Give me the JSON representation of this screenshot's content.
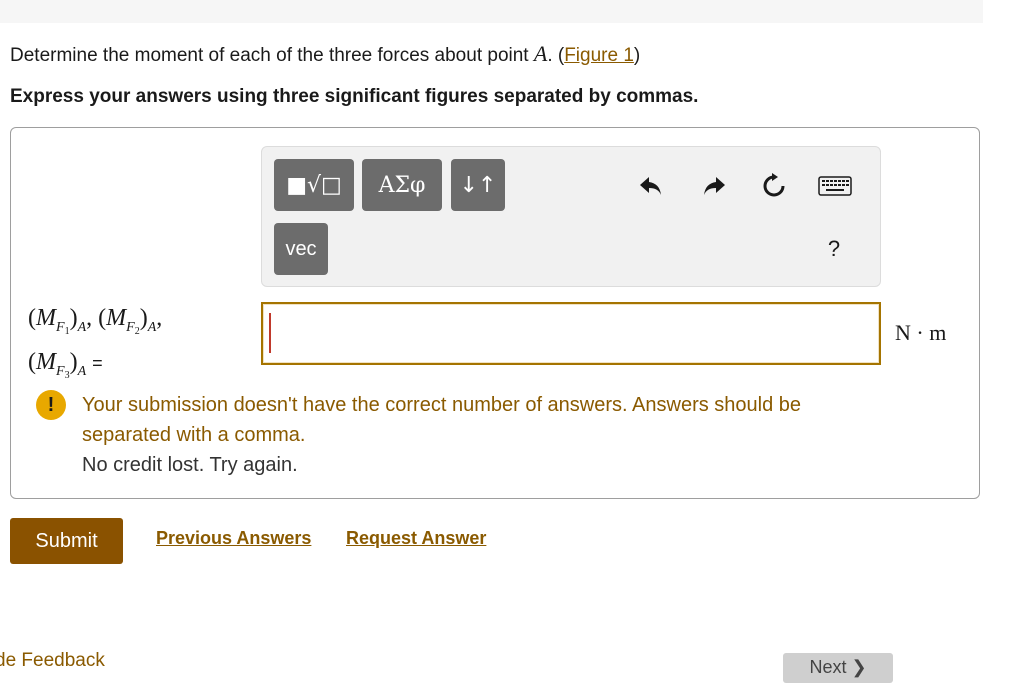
{
  "question": {
    "prefix": "Determine the moment of each of the three forces about point ",
    "point": "A",
    "middle": ". (",
    "figure_link": "Figure 1",
    "suffix": ")"
  },
  "instructions": "Express your answers using three significant figures separated by commas.",
  "toolbar": {
    "templates_glyph": "■√□",
    "greek_label": "ΑΣφ",
    "arrows_label": "↓↑",
    "vec_label": "vec",
    "help_label": "?",
    "undo_icon": "undo-icon",
    "redo_icon": "redo-icon",
    "reset_icon": "reset-icon",
    "keyboard_icon": "keyboard-icon"
  },
  "answer": {
    "value": "",
    "units": "N · m"
  },
  "feedback": {
    "message": "Your submission doesn't have the correct number of answers. Answers should be separated with a comma.",
    "sub": "No credit lost. Try again.",
    "icon_color": "#e8a800",
    "text_color": "#8a5a00"
  },
  "actions": {
    "submit_label": "Submit",
    "previous_answers_label": "Previous Answers",
    "request_answer_label": "Request Answer",
    "provide_feedback_label": "de Feedback",
    "next_label": "Next ❯"
  },
  "colors": {
    "accent": "#8a5200",
    "input_border": "#a57400"
  }
}
